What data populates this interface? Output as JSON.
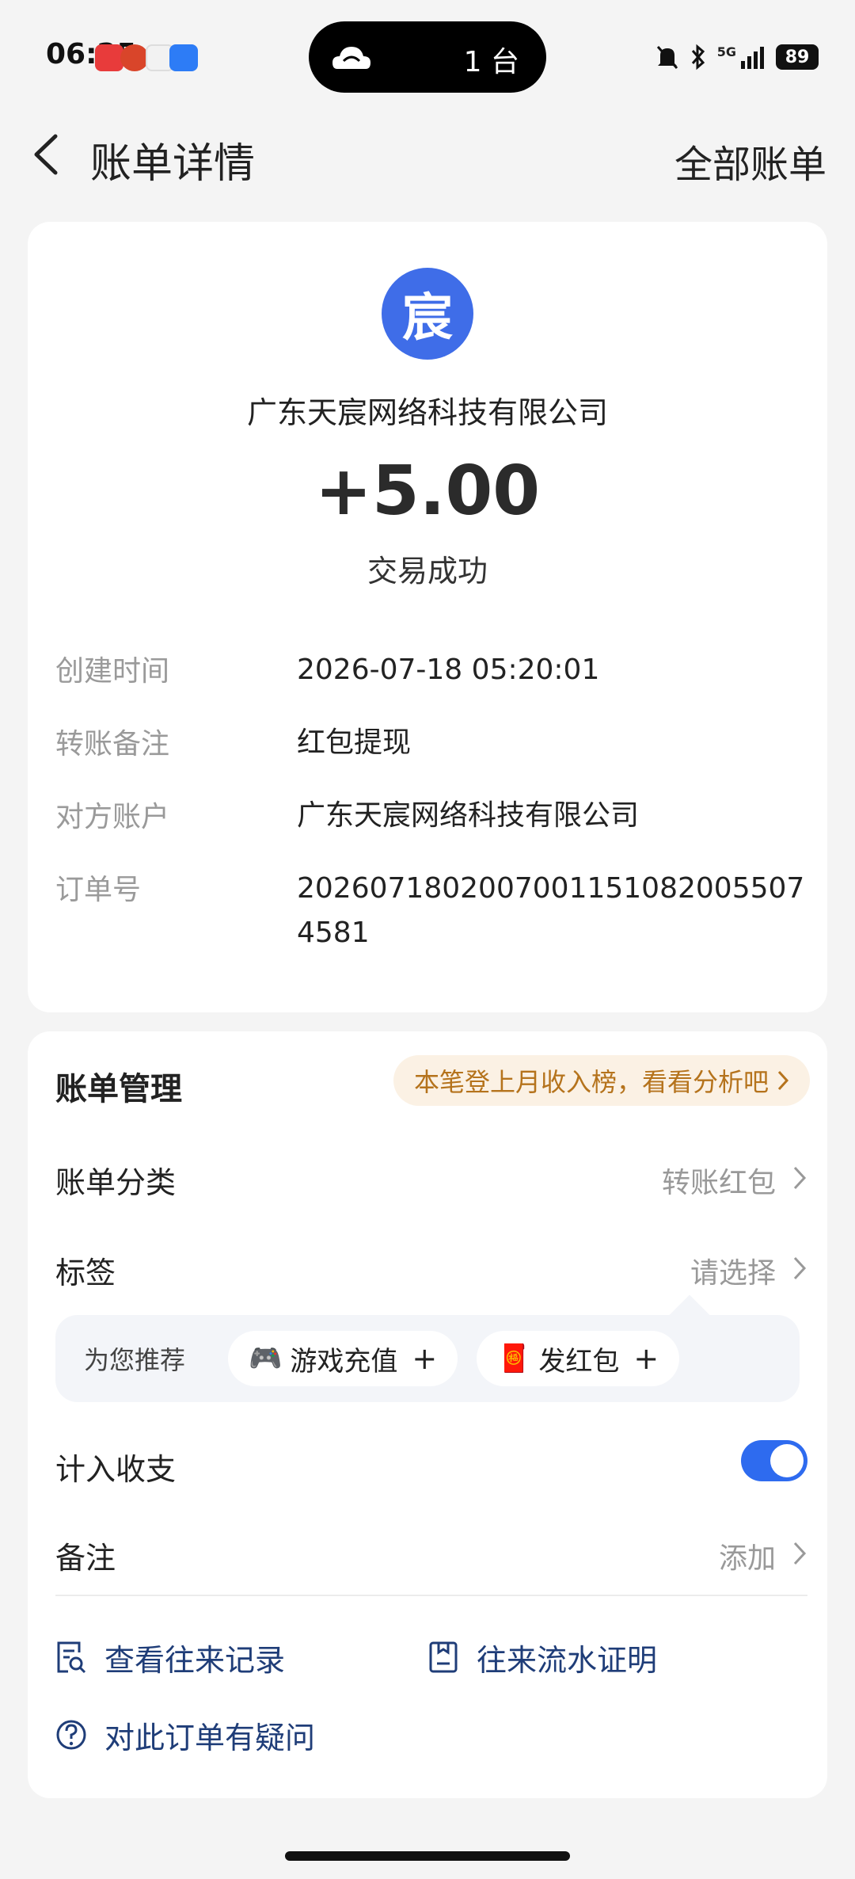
{
  "status_bar": {
    "time": "06:25",
    "island_count": "1 台",
    "network": "5G",
    "battery": "89"
  },
  "header": {
    "title": "账单详情",
    "right_link": "全部账单"
  },
  "transaction": {
    "avatar_char": "宸",
    "payer": "广东天宸网络科技有限公司",
    "amount": "+5.00",
    "status": "交易成功",
    "details": [
      {
        "label": "创建时间",
        "value": "2026-07-18 05:20:01"
      },
      {
        "label": "转账备注",
        "value": "红包提现"
      },
      {
        "label": "对方账户",
        "value": "广东天宸网络科技有限公司"
      },
      {
        "label": "订单号",
        "value": "20260718020070011510820055074581"
      }
    ]
  },
  "management": {
    "title": "账单管理",
    "rank_badge": "本笔登上月收入榜，看看分析吧",
    "category": {
      "label": "账单分类",
      "value": "转账红包"
    },
    "tag": {
      "label": "标签",
      "value": "请选择"
    },
    "recommend": {
      "label": "为您推荐",
      "chips": [
        {
          "icon": "🎮",
          "text": "游戏充值",
          "plus": "+"
        },
        {
          "icon": "🧧",
          "text": "发红包",
          "plus": "+"
        }
      ]
    },
    "include_in_budget": {
      "label": "计入收支",
      "enabled": true
    },
    "note": {
      "label": "备注",
      "value": "添加"
    },
    "links": {
      "history": "查看往来记录",
      "statement": "往来流水证明",
      "question": "对此订单有疑问"
    }
  },
  "colors": {
    "accent": "#2e6bef",
    "avatar_bg": "#3f6de8",
    "link": "#1f3d78",
    "badge_text": "#b5731c",
    "badge_bg": "#fbf1e4"
  }
}
